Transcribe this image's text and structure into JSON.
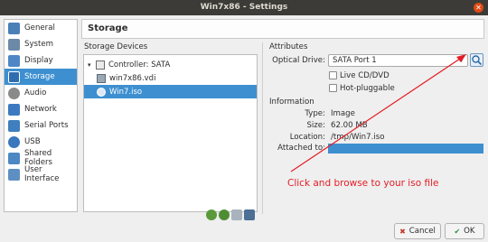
{
  "window": {
    "title": "Win7x86 - Settings"
  },
  "sidebar": {
    "items": [
      {
        "label": "General",
        "icon": "general-icon",
        "color": "#4a7fb8"
      },
      {
        "label": "System",
        "icon": "system-icon",
        "color": "#6c8aa8"
      },
      {
        "label": "Display",
        "icon": "display-icon",
        "color": "#4f86c6"
      },
      {
        "label": "Storage",
        "icon": "storage-icon",
        "color": "#2f6db0",
        "selected": true
      },
      {
        "label": "Audio",
        "icon": "audio-icon",
        "color": "#8a8a8a"
      },
      {
        "label": "Network",
        "icon": "network-icon",
        "color": "#3b7ac0"
      },
      {
        "label": "Serial Ports",
        "icon": "serial-ports-icon",
        "color": "#3f7fbf"
      },
      {
        "label": "USB",
        "icon": "usb-icon",
        "color": "#3a78bd"
      },
      {
        "label": "Shared Folders",
        "icon": "shared-folders-icon",
        "color": "#4d88c4"
      },
      {
        "label": "User Interface",
        "icon": "user-interface-icon",
        "color": "#5e8fc2"
      }
    ]
  },
  "header": {
    "title": "Storage"
  },
  "storage": {
    "devices_label": "Storage Devices",
    "tree": [
      {
        "label": "Controller: SATA",
        "level": 0,
        "icon": "controller-icon"
      },
      {
        "label": "win7x86.vdi",
        "level": 1,
        "icon": "hard-disk-icon"
      },
      {
        "label": "Win7.iso",
        "level": 1,
        "icon": "optical-disc-icon",
        "selected": true
      }
    ]
  },
  "attributes": {
    "label": "Attributes",
    "optical_drive_label": "Optical Drive:",
    "optical_drive_value": "SATA Port 1",
    "live_cd_label": "Live CD/DVD",
    "hot_pluggable_label": "Hot-pluggable"
  },
  "information": {
    "label": "Information",
    "type_label": "Type:",
    "type_value": "Image",
    "size_label": "Size:",
    "size_value": "62.00 MB",
    "location_label": "Location:",
    "location_value": "/tmp/Win7.iso",
    "attached_label": "Attached to:"
  },
  "annotation": {
    "text": "Click and browse to your iso file",
    "color": "#e31e27"
  },
  "buttons": {
    "cancel": "Cancel",
    "ok": "OK"
  },
  "colors": {
    "accent": "#3d8fd0",
    "titlebar": "#3c3b37"
  }
}
